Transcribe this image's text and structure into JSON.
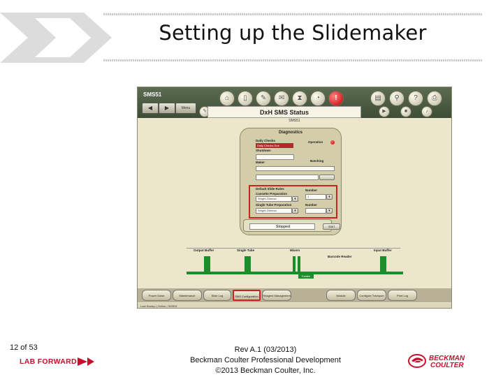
{
  "slide": {
    "title": "Setting up the Slidemaker",
    "page_number": "12 of 53",
    "brand_left": "LAB FORWARD",
    "footer_lines": [
      "Rev A.1 (03/2013)",
      "Beckman Coulter Professional Development",
      "©2013 Beckman Coulter, Inc."
    ],
    "logo_text": "BECKMAN COULTER"
  },
  "screen": {
    "system_id": "SMS51",
    "menu_label": "Menu",
    "status_title": "DxH SMS Status",
    "status_subtitle": "SMS51",
    "diagnostics": {
      "heading": "Diagnostics",
      "daily_checks": "Daily Checks",
      "daily_checks_badge": "Daily Checks Due",
      "shutdown": "Shutdown",
      "operation": "Operation",
      "batching": "Batching",
      "maker": "Maker",
      "default_slide_rules": "Default Slide Rules",
      "cassette_preparation": "Cassette Preparation",
      "single_tube_preparation": "Single Tube Preparation",
      "number_label_1": "Number",
      "number_label_2": "Number",
      "number_value": "1",
      "cassette_value": "Wright-Giemsa",
      "single_tube_value": "Wright-Giemsa",
      "state": "Stopped",
      "start_button": "start"
    },
    "track_labels": [
      "Output Buffer",
      "Single Tube",
      "Mixers",
      "Barcode Reader",
      "Input Buffer"
    ],
    "track_sub_label": "Transfer",
    "bottom_buttons": [
      "Power Down",
      "Maintenance",
      "Slide Log",
      "SMS Configuration",
      "Reagent Management",
      "Module",
      "Configure Transport",
      "Print Log"
    ],
    "highlighted_button": "SMS Configuration",
    "status_bar": "Last Startup | Online | SMS51",
    "colors": {
      "accent_red": "#d01f1f",
      "brand_red": "#c8102e",
      "track_green": "#1f8c2c"
    },
    "icons": [
      "home-icon",
      "door-icon",
      "edit-icon",
      "mail-icon",
      "hourglass-icon",
      "gauge-icon",
      "alert-icon",
      "printer-icon",
      "search-icon",
      "help-icon",
      "print-icon",
      "back-icon",
      "forward-icon",
      "play-icon",
      "stop-icon",
      "speaker-icon"
    ]
  }
}
